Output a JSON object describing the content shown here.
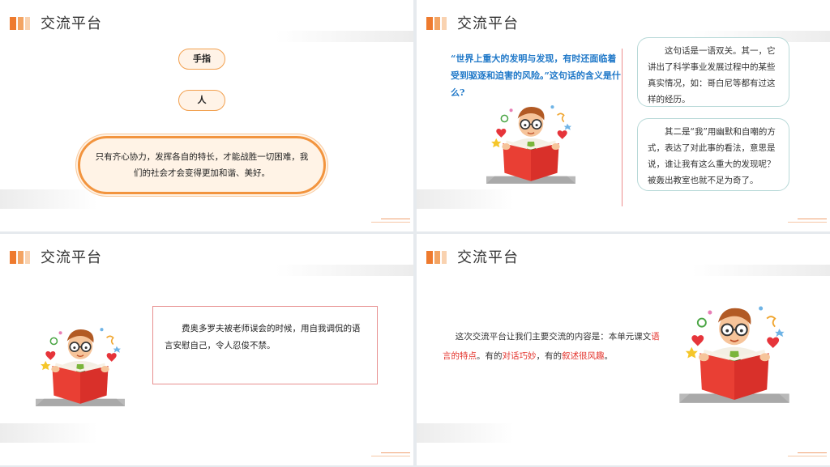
{
  "panels": [
    {
      "title": "交流平台",
      "pill1": "手指",
      "pill2": "人",
      "cloud_text": "只有齐心协力，发挥各自的特长，才能战胜一切困难，我们的社会才会变得更加和谐、美好。"
    },
    {
      "title": "交流平台",
      "question": "“世界上重大的发明与发现，有时还面临着受到驱逐和迫害的风险。”这句话的含义是什么?",
      "answer1": "这句话是一语双关。其一，它讲出了科学事业发展过程中的某些真实情况，如：哥白尼等都有过这样的经历。",
      "answer2": "其二是“我”用幽默和自嘲的方式，表达了对此事的看法，意思是说，谁让我有这么重大的发现呢？被轰出教室也就不足为奇了。"
    },
    {
      "title": "交流平台",
      "speech": "费奥多罗夫被老师误会的时候，用自我调侃的语言安慰自己，令人忍俊不禁。"
    },
    {
      "title": "交流平台",
      "text_a": "这次交流平台让我们主要交流的内容是：本单元课文",
      "hl1": "语言的特点",
      "text_b": "。有的",
      "hl2": "对话巧妙",
      "text_c": "，有的",
      "hl3": "叙述很风趣",
      "text_d": "。"
    }
  ]
}
